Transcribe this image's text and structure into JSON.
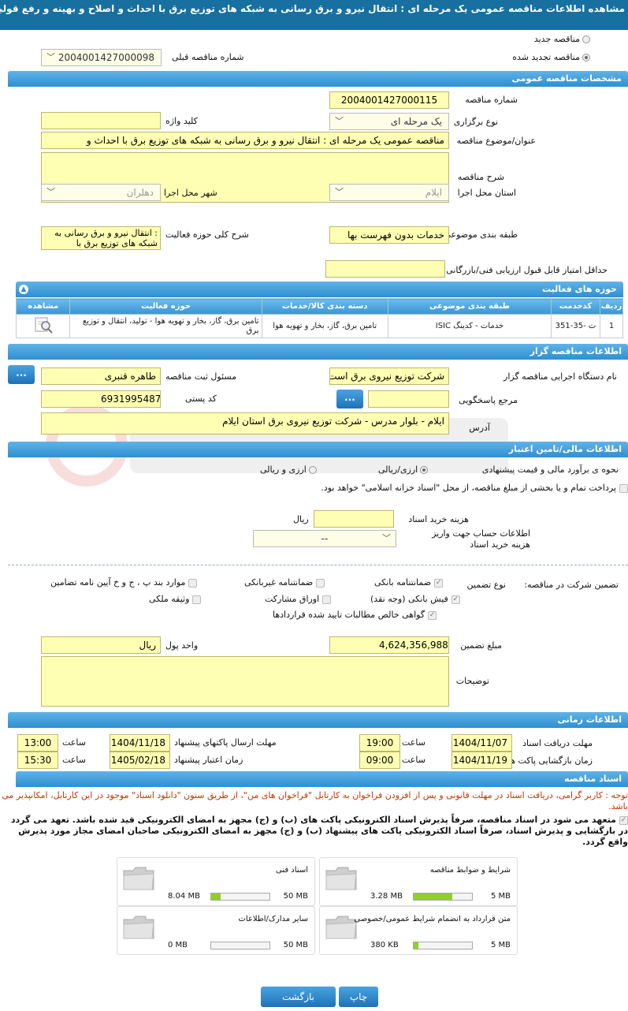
{
  "page_title": "مشاهده اطلاعات مناقصه عمومی یک مرحله ای : انتقال نیرو و برق رسانی به شبکه های توزیع برق با احداث و اصلاح و بهینه و رفع قولیاری ترانسهای شهرستان دهلران از محل اعتب",
  "tender_type": {
    "new_label": "مناقصه جدید",
    "renewed_label": "مناقصه تجدید شده",
    "prev_number_label": "شماره مناقصه قبلی",
    "prev_number_value": "2004001427000098"
  },
  "sections": {
    "general": "مشخصات مناقصه عمومی",
    "activities": "حوزه های فعالیت",
    "organizer": "اطلاعات مناقصه گزار",
    "financial": "اطلاعات مالی/تامین اعتبار",
    "timing": "اطلاعات زمانی",
    "documents": "اسناد مناقصه"
  },
  "general": {
    "number_label": "شماره مناقصه",
    "number_value": "2004001427000115",
    "holding_type_label": "نوع برگزاری",
    "holding_type_value": "یک مرحله ای",
    "keyword_label": "کلید واژه",
    "keyword_value": "",
    "subject_label": "عنوان/موضوع مناقصه",
    "subject_value": "مناقصه عمومی یک مرحله ای : انتقال نیرو و برق رسانی به شبکه های توزیع برق با   احداث و",
    "description_label": "شرح مناقصه",
    "description_value": "",
    "province_label": "استان محل اجرا",
    "province_value": "ایلام",
    "city_label": "شهر محل اجرا",
    "city_value": "دهلران",
    "category_label": "طبقه بندی موضوعی",
    "category_value": "خدمات بدون فهرست بها",
    "activity_desc_label": "شرح کلی حوزه فعالیت",
    "activity_desc_value": ": انتقال نیرو و برق رسانی به شبکه های توزیع برق با",
    "min_score_label": "حداقل امتیاز قابل قبول ارزیابی فنی/بازرگانی",
    "min_score_value": ""
  },
  "activities": {
    "headers": [
      "ردیف",
      "کدخدمت",
      "طبقه بندی موضوعی",
      "دسته بندی کالا/خدمات",
      "حوزه فعالیت",
      "مشاهده"
    ],
    "rows": [
      {
        "row": "1",
        "code": "ت -35-351",
        "category": "خدمات - کدینگ ISIC",
        "group": "تامین برق، گاز، بخار و تهویه هوا",
        "field": "تامین برق، گاز، بخار و تهویه هوا - تولید، انتقال و توزیع برق"
      }
    ]
  },
  "organizer": {
    "org_label": "نام دستگاه اجرایی مناقصه گزار",
    "org_value": "شرکت توزیع نیروی برق است",
    "responsible_label": "مسئول ثبت مناقصه",
    "responsible_value": "طاهره قنبری",
    "reference_label": "مرجع پاسخگویی",
    "reference_value": "",
    "postal_label": "کد پستی",
    "postal_value": "6931995487",
    "address_label": "آدرس",
    "address_value": "ایلام - بلوار مدرس - شرکت توزیع نیروی برق استان ایلام",
    "more_button": "...",
    "ref_button": "..."
  },
  "financial": {
    "estimate_label": "نحوه ی برآورد مالی و قیمت پیشنهادی",
    "currency_rial": "ارزی/ریالی",
    "currency_both": "ارزی و ریالی",
    "treasury_text": "پرداخت تمام و یا بخشی از مبلغ مناقصه، از محل \"اسناد خزانه اسلامی\" خواهد بود.",
    "doc_cost_label": "هزینه خرید اسناد",
    "doc_cost_value": "",
    "doc_cost_unit": "ریال",
    "account_label": "اطلاعات حساب جهت واریز هزینه خرید اسناد",
    "account_value": "--"
  },
  "guarantee": {
    "label": "تضمین شرکت در مناقصه:",
    "type_label": "نوع تضمین",
    "options": [
      "ضمانتنامه بانکی",
      "ضمانتنامه غیربانکی",
      "موارد بند پ ، ج و خ آیین نامه تضامین",
      "فیش بانکی (وجه نقد)",
      "اوراق مشارکت",
      "وثیقه ملکی",
      "گواهی خالص مطالبات تایید شده قراردادها"
    ],
    "amount_label": "مبلغ تضمین",
    "amount_value": "4,624,356,988",
    "currency_label": "واحد پول",
    "currency_value": "ریال",
    "notes_label": "توضیحات",
    "notes_value": ""
  },
  "timing": {
    "receive_label": "مهلت دریافت اسناد",
    "receive_date": "1404/11/07",
    "receive_time_label": "ساعت",
    "receive_time": "19:00",
    "send_label": "مهلت ارسال پاکتهای پیشنهاد",
    "send_date": "1404/11/18",
    "send_time_label": "ساعت",
    "send_time": "13:00",
    "open_label": "زمان بازگشایی پاکت ها",
    "open_date": "1404/11/19",
    "open_time_label": "ساعت",
    "open_time": "09:00",
    "validity_label": "زمان اعتبار پیشنهاد",
    "validity_date": "1405/02/18",
    "validity_time_label": "ساعت",
    "validity_time": "15:30"
  },
  "documents": {
    "note": "توجه : کاربر گرامی، دریافت اسناد در مهلت قانونی و پس از افزودن فراخوان به کارتابل \"فراخوان های من\"، از طریق ستون \"دانلود اسناد\" موجود در این کارتابل، امکانپذیر می باشد.",
    "commitment": "متعهد می شود در اسناد مناقصه، صرفاً پذیرش اسناد الکترونیکی پاکت های (ب) و (ج) مجهز به امضای الکترونیکی قید شده باشد. تعهد می گردد در بازگشایی و پذیرش اسناد، صرفاً اسناد الکترونیکی پاکت های پیشنهاد (ب) و (ج) مجهز به امضای الکترونیکی صاحبان امضای مجاز مورد پذیرش واقع گردد.",
    "files": [
      {
        "name": "شرایط و ضوابط مناقصه",
        "size": "3.28 MB",
        "max": "5 MB",
        "fill": 0.66
      },
      {
        "name": "اسناد فنی",
        "size": "8.04 MB",
        "max": "50 MB",
        "fill": 0.16
      },
      {
        "name": "متن قرارداد به انضمام شرایط عمومی/خصوصی",
        "size": "380 KB",
        "max": "5 MB",
        "fill": 0.08
      },
      {
        "name": "سایر مدارک/اطلاعات",
        "size": "0 MB",
        "max": "50 MB",
        "fill": 0
      }
    ]
  },
  "footer": {
    "print": "چاپ",
    "back": "بازگشت"
  },
  "colors": {
    "header": "#17709f",
    "section": "#2f8fd0",
    "field": "#ffffb3",
    "accent_red": "#cc3300"
  }
}
